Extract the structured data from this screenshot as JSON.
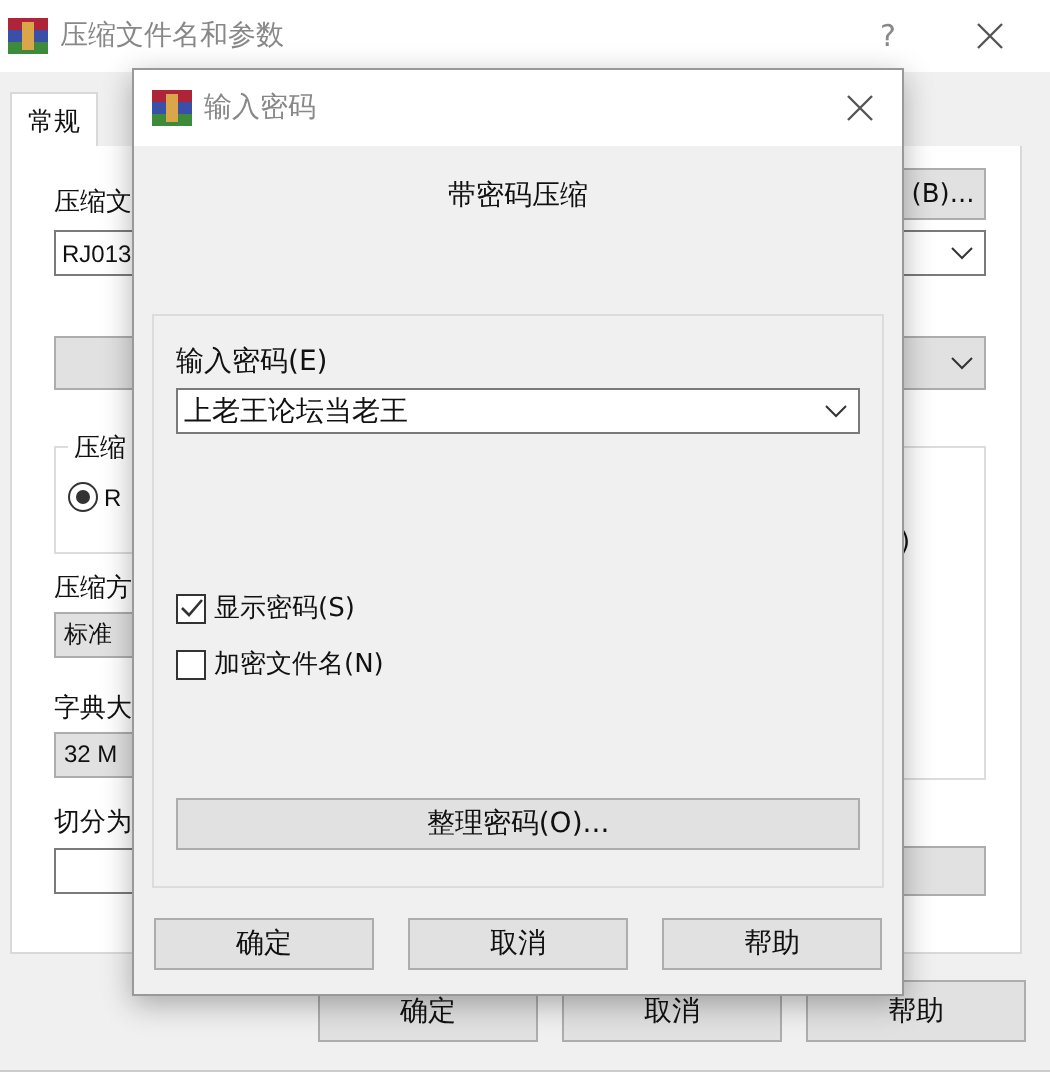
{
  "window": {
    "title": "压缩文件名和参数",
    "help": "?"
  },
  "tabs": [
    {
      "label": "常规",
      "selected": true
    }
  ],
  "archive_name": {
    "label": "压缩文",
    "value": "RJ013",
    "browse_button": "(B)..."
  },
  "format_group": {
    "title": "压缩",
    "options": [
      {
        "label": "R",
        "selected": true
      }
    ]
  },
  "options_group": {
    "text": ")"
  },
  "method": {
    "label": "压缩方",
    "value": "标准"
  },
  "dictionary": {
    "label": "字典大",
    "value": "32 M"
  },
  "split": {
    "label": "切分为"
  },
  "buttons": [
    "确定",
    "取消",
    "帮助"
  ],
  "dialog": {
    "title": "输入密码",
    "heading": "带密码压缩",
    "password_label": "输入密码(E)",
    "password_value": "上老王论坛当老王",
    "options": [
      {
        "label": "显示密码(S)",
        "checked": true
      },
      {
        "label": "加密文件名(N)",
        "checked": false
      }
    ],
    "organize_button": "整理密码(O)...",
    "buttons": [
      "确定",
      "取消",
      "帮助"
    ]
  }
}
